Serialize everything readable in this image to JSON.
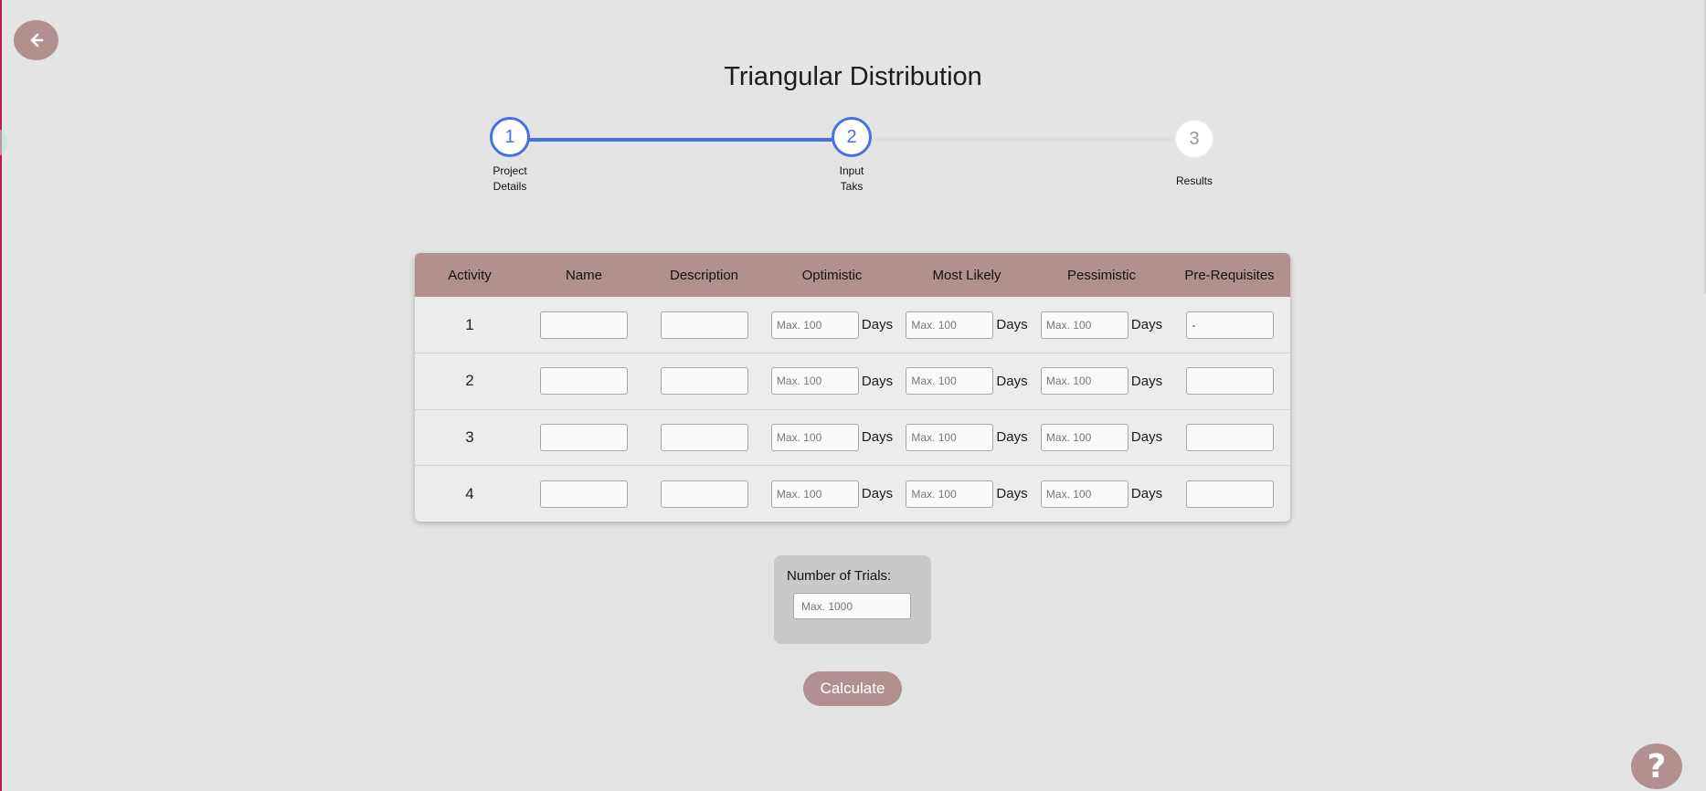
{
  "page": {
    "title": "Triangular Distribution",
    "accent_color": "#4472e5",
    "brand_color": "#b39090"
  },
  "nav": {
    "back_icon": "arrow-left-icon",
    "help_label": "?"
  },
  "stepper": {
    "steps": [
      {
        "number": "1",
        "label_line1": "Project",
        "label_line2": "Details",
        "state": "done"
      },
      {
        "number": "2",
        "label_line1": "Input",
        "label_line2": "Taks",
        "state": "current"
      },
      {
        "number": "3",
        "label_line1": "Results",
        "label_line2": "",
        "state": "upcoming"
      }
    ]
  },
  "table": {
    "headers": [
      "Activity",
      "Name",
      "Description",
      "Optimistic",
      "Most Likely",
      "Pessimistic",
      "Pre-Requisites"
    ],
    "unit_label": "Days",
    "duration_placeholder": "Max. 100",
    "rows": [
      {
        "activity": "1",
        "prerequisites": "-"
      },
      {
        "activity": "2",
        "prerequisites": ""
      },
      {
        "activity": "3",
        "prerequisites": ""
      },
      {
        "activity": "4",
        "prerequisites": ""
      }
    ]
  },
  "trials": {
    "label": "Number of Trials:",
    "placeholder": "Max. 1000"
  },
  "actions": {
    "calculate_label": "Calculate"
  }
}
